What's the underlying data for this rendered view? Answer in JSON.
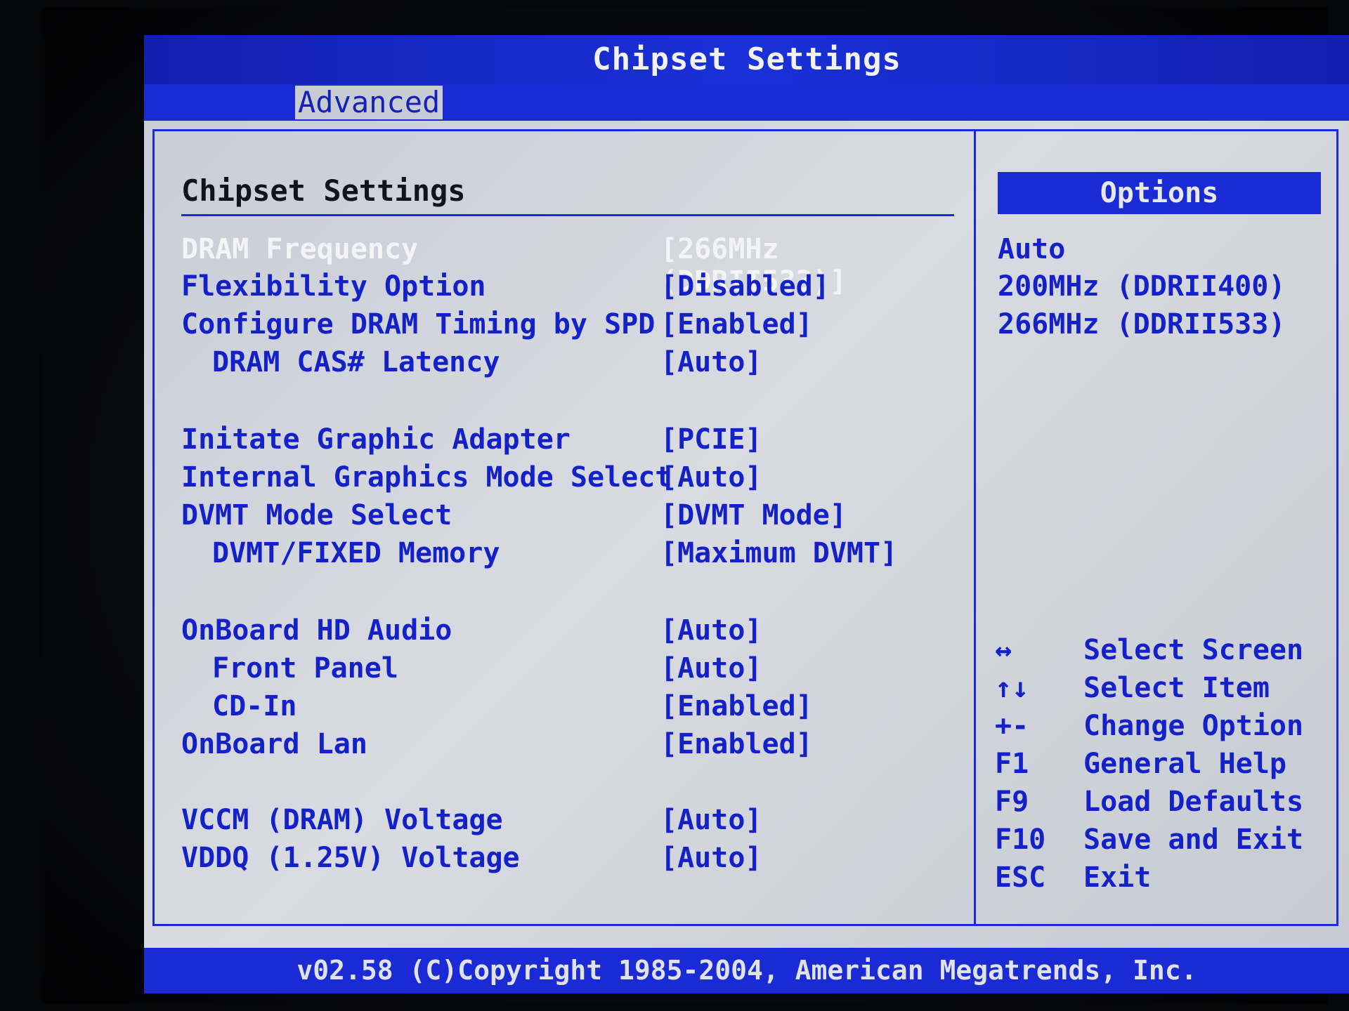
{
  "title_bar": {
    "title": "Chipset Settings"
  },
  "tabs": [
    {
      "label": "Advanced"
    }
  ],
  "main": {
    "heading": "Chipset Settings",
    "settings": [
      {
        "label": "DRAM Frequency",
        "value": "[266MHz (DDRII533)]",
        "indent": 0,
        "selected": true
      },
      {
        "label": "Flexibility Option",
        "value": "[Disabled]",
        "indent": 0
      },
      {
        "label": "Configure DRAM Timing by SPD",
        "value": "[Enabled]",
        "indent": 0
      },
      {
        "label": "DRAM CAS# Latency",
        "value": "[Auto]",
        "indent": 1
      },
      {
        "label": "Initate Graphic Adapter",
        "value": "[PCIE]",
        "indent": 0
      },
      {
        "label": "Internal Graphics Mode Select",
        "value": "[Auto]",
        "indent": 0
      },
      {
        "label": "DVMT Mode Select",
        "value": "[DVMT Mode]",
        "indent": 0
      },
      {
        "label": "DVMT/FIXED Memory",
        "value": "[Maximum DVMT]",
        "indent": 1
      },
      {
        "label": "OnBoard HD Audio",
        "value": "[Auto]",
        "indent": 0
      },
      {
        "label": "Front Panel",
        "value": "[Auto]",
        "indent": 1
      },
      {
        "label": "CD-In",
        "value": "[Enabled]",
        "indent": 1
      },
      {
        "label": "OnBoard Lan",
        "value": "[Enabled]",
        "indent": 0
      },
      {
        "label": "VCCM (DRAM) Voltage",
        "value": "[Auto]",
        "indent": 0
      },
      {
        "label": "VDDQ (1.25V) Voltage",
        "value": "[Auto]",
        "indent": 0
      }
    ]
  },
  "options": {
    "header": "Options",
    "items": [
      "Auto",
      "200MHz (DDRII400)",
      "266MHz (DDRII533)"
    ]
  },
  "help": [
    {
      "key": "↔",
      "desc": "Select Screen"
    },
    {
      "key": "↑↓",
      "desc": "Select Item"
    },
    {
      "key": "+-",
      "desc": "Change Option"
    },
    {
      "key": "F1",
      "desc": "General Help"
    },
    {
      "key": "F9",
      "desc": "Load Defaults"
    },
    {
      "key": "F10",
      "desc": "Save and Exit"
    },
    {
      "key": "ESC",
      "desc": "Exit"
    }
  ],
  "footer": {
    "text": "v02.58 (C)Copyright 1985-2004, American Megatrends, Inc."
  },
  "colors": {
    "bios_blue": "#1a2bd6",
    "panel_gray": "#cfd3da",
    "text_blue": "#1420c8",
    "selected_text": "#f4f4f6"
  }
}
